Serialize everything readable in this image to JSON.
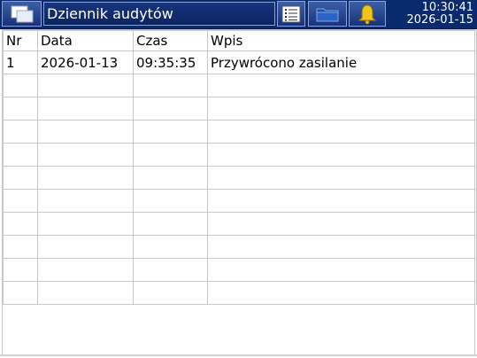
{
  "header": {
    "title": "Dziennik audytów",
    "time": "10:30:41",
    "date": "2026-01-15",
    "icons": [
      "windows-icon",
      "list-icon",
      "folder-icon",
      "bell-icon"
    ]
  },
  "table": {
    "columns": [
      "Nr",
      "Data",
      "Czas",
      "Wpis"
    ],
    "rows": [
      [
        "1",
        "2026-01-13",
        "09:35:35",
        "Przywrócono zasilanie"
      ]
    ]
  },
  "colors": {
    "header_bg": "#0a2a6e",
    "grid": "#c8c8c8",
    "bell": "#e8b400"
  }
}
